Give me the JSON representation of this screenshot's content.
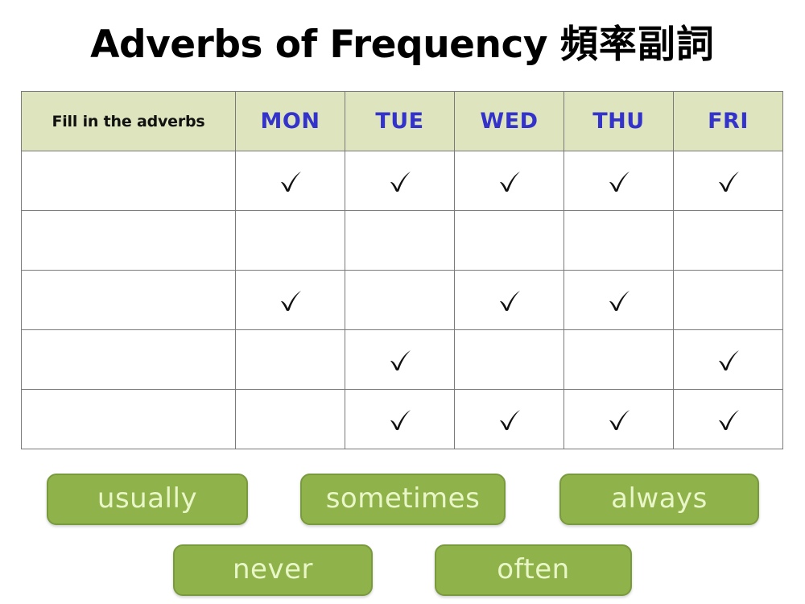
{
  "title": {
    "english": "Adverbs of Frequency",
    "chinese": "頻率副詞"
  },
  "table": {
    "prompt_header": "Fill in the adverbs",
    "day_headers": [
      "MON",
      "TUE",
      "WED",
      "THU",
      "FRI"
    ],
    "check_glyph": "✓",
    "rows": [
      {
        "adverb_answer": "",
        "checks": [
          true,
          true,
          true,
          true,
          true
        ]
      },
      {
        "adverb_answer": "",
        "checks": [
          false,
          false,
          false,
          false,
          false
        ]
      },
      {
        "adverb_answer": "",
        "checks": [
          true,
          false,
          true,
          true,
          false
        ]
      },
      {
        "adverb_answer": "",
        "checks": [
          false,
          true,
          false,
          false,
          true
        ]
      },
      {
        "adverb_answer": "",
        "checks": [
          false,
          true,
          true,
          true,
          true
        ]
      }
    ]
  },
  "word_bank": {
    "row1": [
      "usually",
      "sometimes",
      "always"
    ],
    "row2": [
      "never",
      "often"
    ]
  },
  "colors": {
    "header_fill": "#dee4be",
    "day_text": "#3333cc",
    "chip_fill": "#8fb24b",
    "chip_border": "#7a9a3e",
    "chip_text": "#e9f7c8",
    "grid_line": "#7a7a7a"
  }
}
